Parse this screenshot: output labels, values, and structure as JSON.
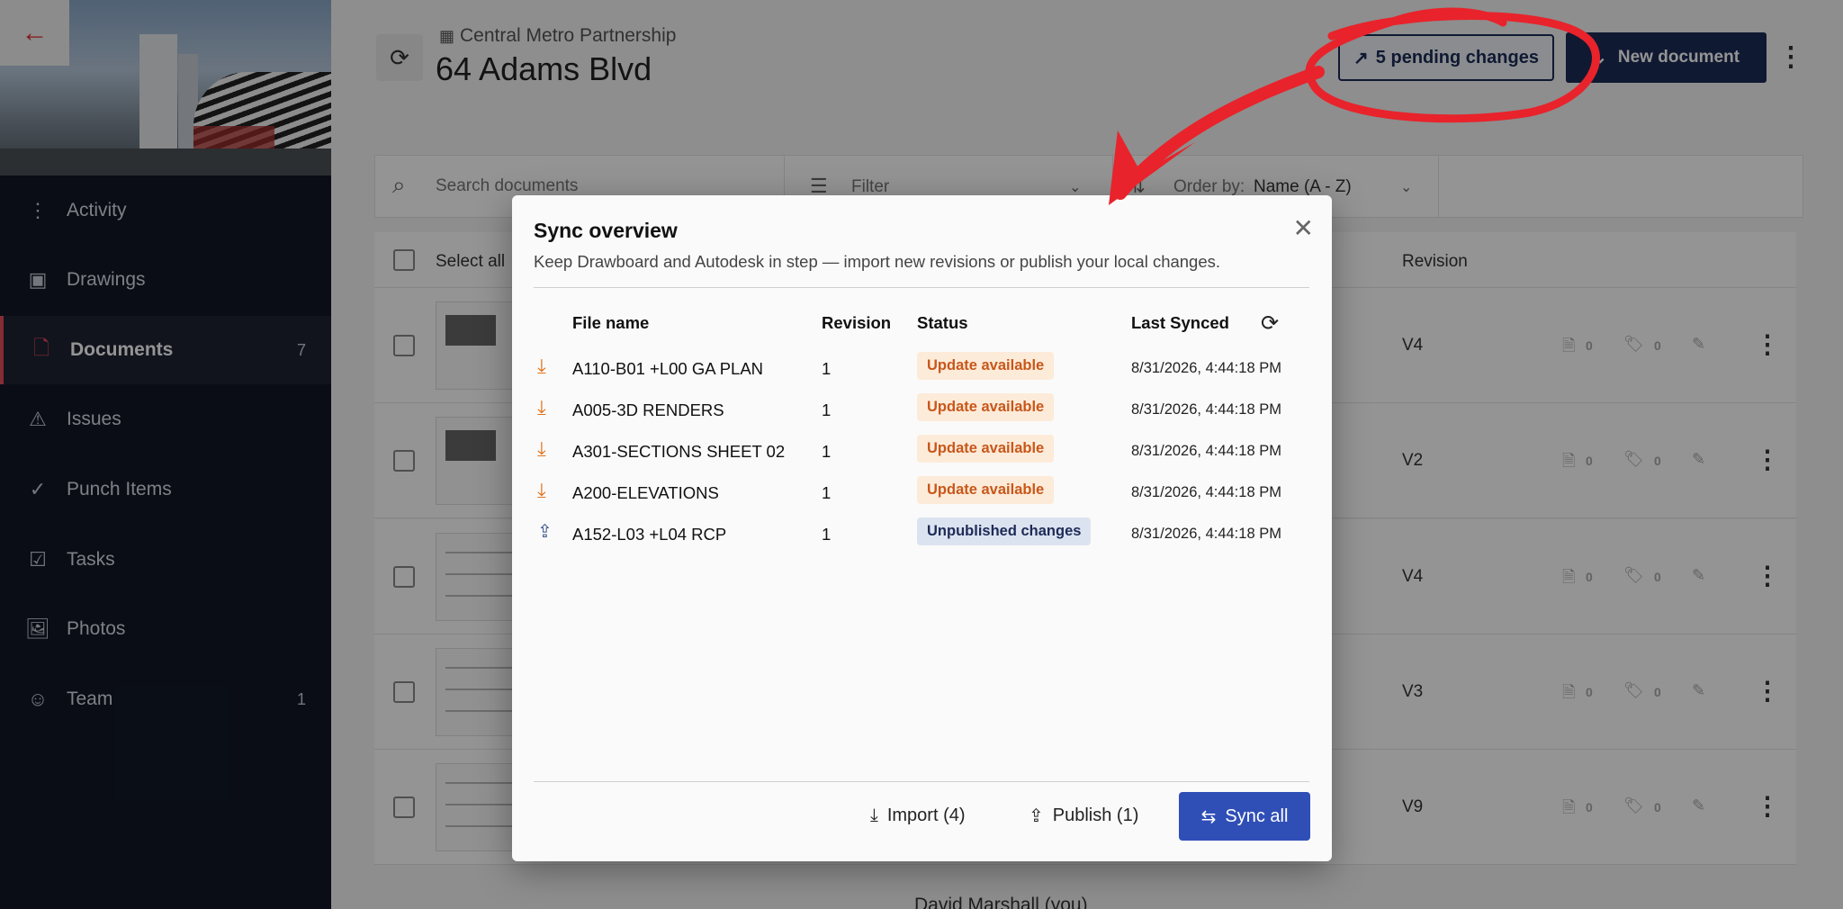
{
  "sidebar": {
    "back_icon": "←",
    "items": [
      {
        "label": "Activity",
        "icon": "activity-icon",
        "glyph": "⋮",
        "count": ""
      },
      {
        "label": "Drawings",
        "icon": "drawings-icon",
        "glyph": "▣",
        "count": ""
      },
      {
        "label": "Documents",
        "icon": "documents-icon",
        "glyph": "🗋",
        "count": "7"
      },
      {
        "label": "Issues",
        "icon": "issues-icon",
        "glyph": "⚠",
        "count": ""
      },
      {
        "label": "Punch Items",
        "icon": "punch-icon",
        "glyph": "✓",
        "count": ""
      },
      {
        "label": "Tasks",
        "icon": "tasks-icon",
        "glyph": "☑",
        "count": ""
      },
      {
        "label": "Photos",
        "icon": "photos-icon",
        "glyph": "🖼",
        "count": ""
      },
      {
        "label": "Team",
        "icon": "team-icon",
        "glyph": "☺",
        "count": "1"
      }
    ]
  },
  "header": {
    "org": "Central Metro Partnership",
    "title": "64 Adams Blvd",
    "pending": "5 pending changes",
    "new_document": "New document"
  },
  "toolbar": {
    "search_placeholder": "Search documents",
    "filter": "Filter",
    "order_label": "Order by:",
    "order_value": "Name (A - Z)"
  },
  "table": {
    "select_all": "Select all",
    "revision_header": "Revision",
    "rows": [
      {
        "revision": "V4",
        "c1": "0",
        "c2": "0"
      },
      {
        "revision": "V2",
        "c1": "0",
        "c2": "0"
      },
      {
        "revision": "V4",
        "c1": "0",
        "c2": "0"
      },
      {
        "revision": "V3",
        "c1": "0",
        "c2": "0"
      },
      {
        "revision": "V9",
        "c1": "0",
        "c2": "0"
      }
    ],
    "partial_row_text": "David Marshall (you)"
  },
  "modal": {
    "title": "Sync overview",
    "subtitle": "Keep Drawboard and Autodesk in step — import new revisions or publish your local changes.",
    "columns": {
      "file": "File name",
      "revision": "Revision",
      "status": "Status",
      "last_synced": "Last Synced"
    },
    "rows": [
      {
        "file": "A110-B01 +L00 GA PLAN",
        "revision": "1",
        "status": "Update available",
        "kind": "import",
        "last_synced": "8/31/2026, 4:44:18 PM"
      },
      {
        "file": "A005-3D RENDERS",
        "revision": "1",
        "status": "Update available",
        "kind": "import",
        "last_synced": "8/31/2026, 4:44:18 PM"
      },
      {
        "file": "A301-SECTIONS SHEET 02",
        "revision": "1",
        "status": "Update available",
        "kind": "import",
        "last_synced": "8/31/2026, 4:44:18 PM"
      },
      {
        "file": "A200-ELEVATIONS",
        "revision": "1",
        "status": "Update available",
        "kind": "import",
        "last_synced": "8/31/2026, 4:44:18 PM"
      },
      {
        "file": "A152-L03 +L04 RCP",
        "revision": "1",
        "status": "Unpublished changes",
        "kind": "publish",
        "last_synced": "8/31/2026, 4:44:18 PM"
      }
    ],
    "import_label": "Import (4)",
    "publish_label": "Publish (1)",
    "sync_label": "Sync all"
  },
  "colors": {
    "accent": "#2f4fb7",
    "navy": "#1d2b57",
    "update_bg": "#fdebd9",
    "update_fg": "#c8571a",
    "unpublished_bg": "#dce3f0",
    "annotation": "#e8232b"
  }
}
